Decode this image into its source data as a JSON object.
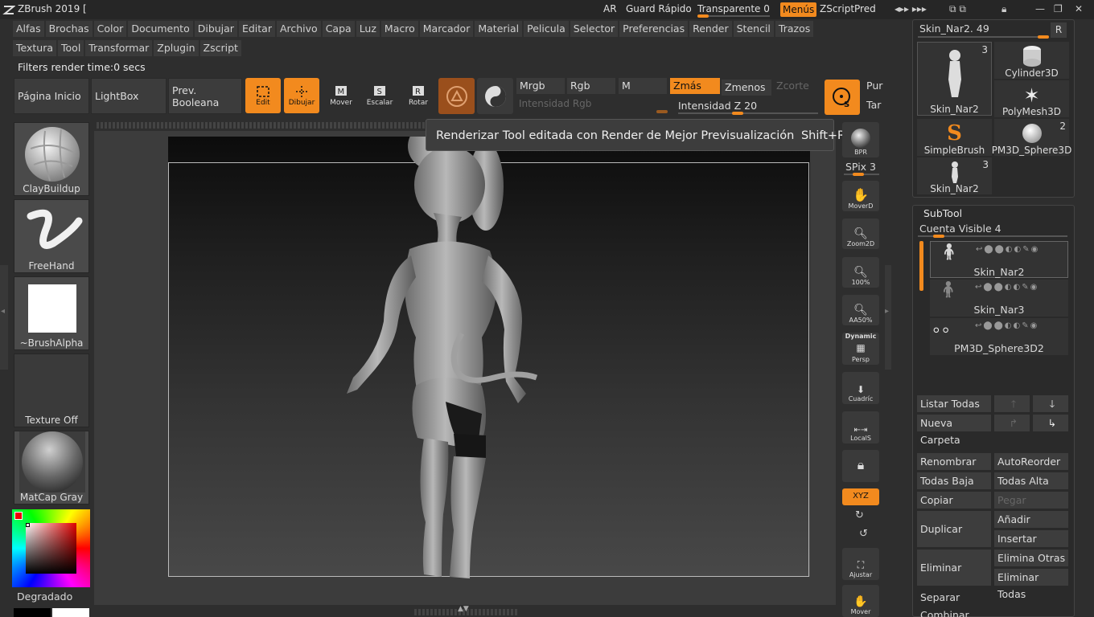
{
  "titlebar": {
    "app_title": "ZBrush 2019 [",
    "ar": "AR",
    "quick_save": "Guard Rápido",
    "transparent": "Transparente 0",
    "menus": "Menús",
    "zscript": "ZScriptPred"
  },
  "menubar": {
    "row1": [
      "Alfas",
      "Brochas",
      "Color",
      "Documento",
      "Dibujar",
      "Editar",
      "Archivo",
      "Capa",
      "Luz",
      "Macro",
      "Marcador",
      "Material",
      "Pelicula",
      "Selector",
      "Preferencias",
      "Render",
      "Stencil",
      "Trazos"
    ],
    "row2": [
      "Textura",
      "Tool",
      "Transformar",
      "Zplugin",
      "Zscript"
    ]
  },
  "status": {
    "text": "Filters render time:0 secs"
  },
  "shelf": {
    "home_page": "Página Inicio",
    "lightbox": "LightBox",
    "prev_boolean": "Prev. Booleana",
    "edit": "Edit",
    "draw": "Dibujar",
    "move": "Mover",
    "scale": "Escalar",
    "rotate": "Rotar",
    "mrgb": "Mrgb",
    "rgb": "Rgb",
    "m": "M",
    "zadd": "Zmás",
    "zsub": "Zmenos",
    "zcut": "Zcorte",
    "rgb_intensity": "Intensidad Rgb",
    "z_intensity": "Intensidad Z 20",
    "pur": "Pur",
    "tar": "Tar"
  },
  "tooltip": {
    "text": "Renderizar Tool editada con Render de Mejor Previsualización",
    "shortcut": "Shift+R"
  },
  "left_panel": {
    "brush": "ClayBuildup",
    "stroke": "FreeHand",
    "alpha": "~BrushAlpha",
    "texture": "Texture Off",
    "material": "MatCap Gray",
    "gradient": "Degradado"
  },
  "right_tools": {
    "bpr": "BPR",
    "spix": "SPix 3",
    "moverd": "MoverD",
    "zoom2d": "Zoom2D",
    "pct100": "100%",
    "aa50": "AA50%",
    "dynamic": "Dynamic",
    "persp": "Persp",
    "cuadric": "Cuadríc",
    "locals": "LocalS",
    "xyz": "XYZ",
    "ajustar": "Ajustar",
    "mover": "Mover"
  },
  "tool_panel": {
    "current_tool": "Skin_Nar2. 49",
    "r": "R",
    "tools": [
      {
        "name": "Skin_Nar2",
        "count": "3"
      },
      {
        "name": "Cylinder3D",
        "count": ""
      },
      {
        "name": "SimpleBrush",
        "count": ""
      },
      {
        "name": "PolyMesh3D",
        "count": ""
      },
      {
        "name": "PM3D_Sphere3D",
        "count": "2"
      },
      {
        "name": "Skin_Nar2",
        "count": "3"
      }
    ]
  },
  "subtool": {
    "title": "SubTool",
    "visible_count": "Cuenta Visible 4",
    "items": [
      "Skin_Nar2",
      "Skin_Nar3",
      "PM3D_Sphere3D2"
    ],
    "list_all": "Listar Todas",
    "new_folder": "Nueva Carpeta",
    "rename": "Renombrar",
    "auto_reorder": "AutoReorder",
    "all_low": "Todas Baja",
    "all_high": "Todas Alta",
    "copy": "Copiar",
    "paste": "Pegar",
    "duplicate": "Duplicar",
    "add": "Añadir",
    "insert": "Insertar",
    "delete": "Eliminar",
    "delete_other": "Elimina Otras",
    "delete_all": "Eliminar Todas",
    "split": "Separar",
    "merge": "Combinar"
  },
  "colors": {
    "accent": "#f28a1e",
    "panel": "#3a3a3a",
    "bg": "#2e2e2e"
  }
}
